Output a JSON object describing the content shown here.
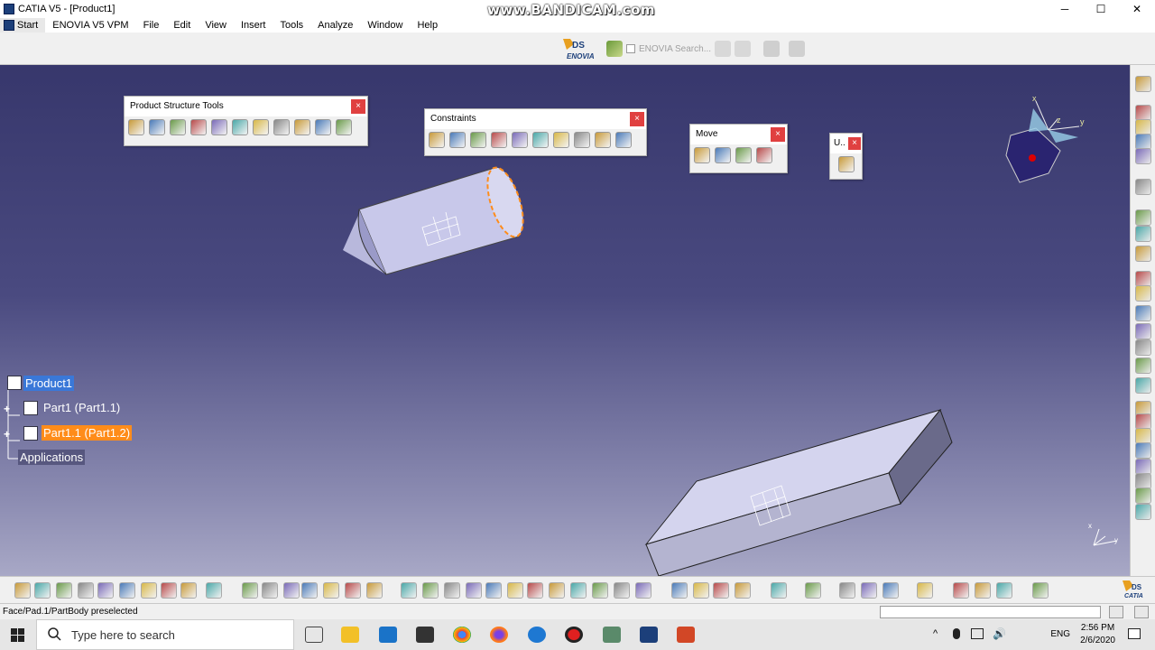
{
  "window": {
    "title": "CATIA V5 - [Product1]",
    "watermark": "www.BANDICAM.com",
    "controls": [
      "─",
      "☐",
      "✕"
    ],
    "mdi_controls": [
      "─",
      "❐",
      "✕"
    ]
  },
  "menu": {
    "items": [
      "Start",
      "ENOVIA V5 VPM",
      "File",
      "Edit",
      "View",
      "Insert",
      "Tools",
      "Analyze",
      "Window",
      "Help"
    ]
  },
  "topstrip": {
    "enovia_logo": "ENOVIA",
    "enovia_search": "ENOVIA Search..."
  },
  "toolbars": {
    "product_structure": {
      "title": "Product Structure Tools",
      "close": "×",
      "icon_count": 11
    },
    "constraints": {
      "title": "Constraints",
      "close": "×",
      "icon_count": 10
    },
    "move": {
      "title": "Move",
      "close": "×",
      "icon_count": 4
    },
    "update": {
      "title": "U..",
      "close": "×",
      "icon_count": 1
    }
  },
  "tree": {
    "root": "Product1",
    "children": [
      "Part1 (Part1.1)",
      "Part1.1 (Part1.2)"
    ],
    "applications": "Applications"
  },
  "compass": {
    "x": "x",
    "y": "y",
    "z": "z"
  },
  "triad": {
    "x": "x",
    "y": "y"
  },
  "status": {
    "text": "Face/Pad.1/PartBody preselected",
    "brand": "CATIA"
  },
  "taskbar": {
    "search_placeholder": "Type here to search",
    "lang": "ENG",
    "time": "2:56 PM",
    "date": "2/6/2020"
  },
  "colors": {
    "viewport_top": "#37376c",
    "viewport_bottom": "#a8a8c6",
    "selection_orange": "#ff8c1a",
    "selection_blue": "#3a78d8",
    "part_face": "#d4d4ee",
    "close_red": "#e04040"
  }
}
